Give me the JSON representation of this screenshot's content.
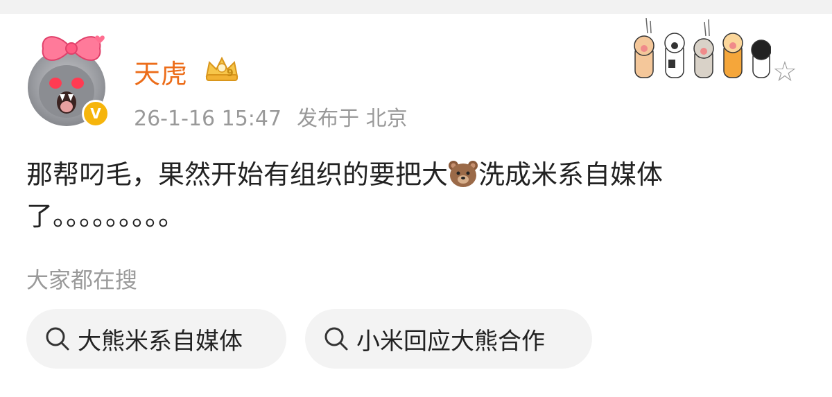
{
  "post": {
    "username": "天虎",
    "level_badge": "9",
    "verified_badge": "V",
    "timestamp": "26-1-16 15:47",
    "location": "发布于 北京",
    "content_before_emoji": "那帮叼毛，果然开始有组织的要把大",
    "emoji": "bear-face-emoji",
    "content_after_emoji": "洗成米系自媒体了。。。。。。。。。"
  },
  "search_section": {
    "label": "大家都在搜",
    "chips": [
      "大熊米系自媒体",
      "小米回应大熊合作"
    ]
  },
  "colors": {
    "username": "#ec6d1a",
    "meta_text": "#999999",
    "chip_bg": "#f3f3f3",
    "verified": "#f6b50c"
  },
  "icons": [
    "bow-icon",
    "verified-icon",
    "crown-badge-icon",
    "cat-paws-decoration",
    "star-icon",
    "search-icon"
  ]
}
